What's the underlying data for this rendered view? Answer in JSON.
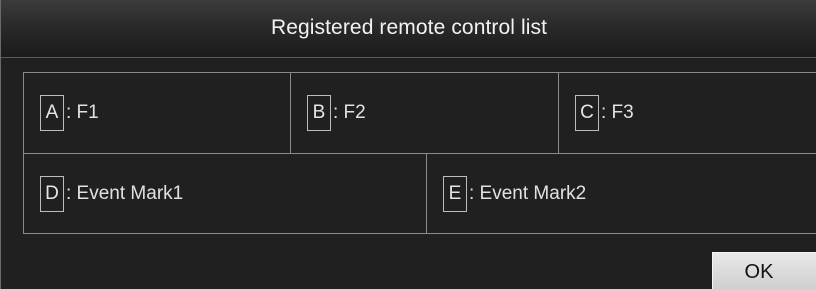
{
  "dialog": {
    "title": "Registered remote control list",
    "ok_label": "OK"
  },
  "remote_list": {
    "rows": [
      {
        "cells": [
          {
            "key": "A",
            "assignment": ": F1"
          },
          {
            "key": "B",
            "assignment": ": F2"
          },
          {
            "key": "C",
            "assignment": ": F3"
          }
        ]
      },
      {
        "cells": [
          {
            "key": "D",
            "assignment": ": Event Mark1"
          },
          {
            "key": "E",
            "assignment": ": Event Mark2"
          }
        ]
      }
    ]
  },
  "colors": {
    "background": "#202020",
    "title_bar": "#2a2a2a",
    "grid_lines": "#8a8a8a",
    "button_face": "#dcdcdc"
  }
}
